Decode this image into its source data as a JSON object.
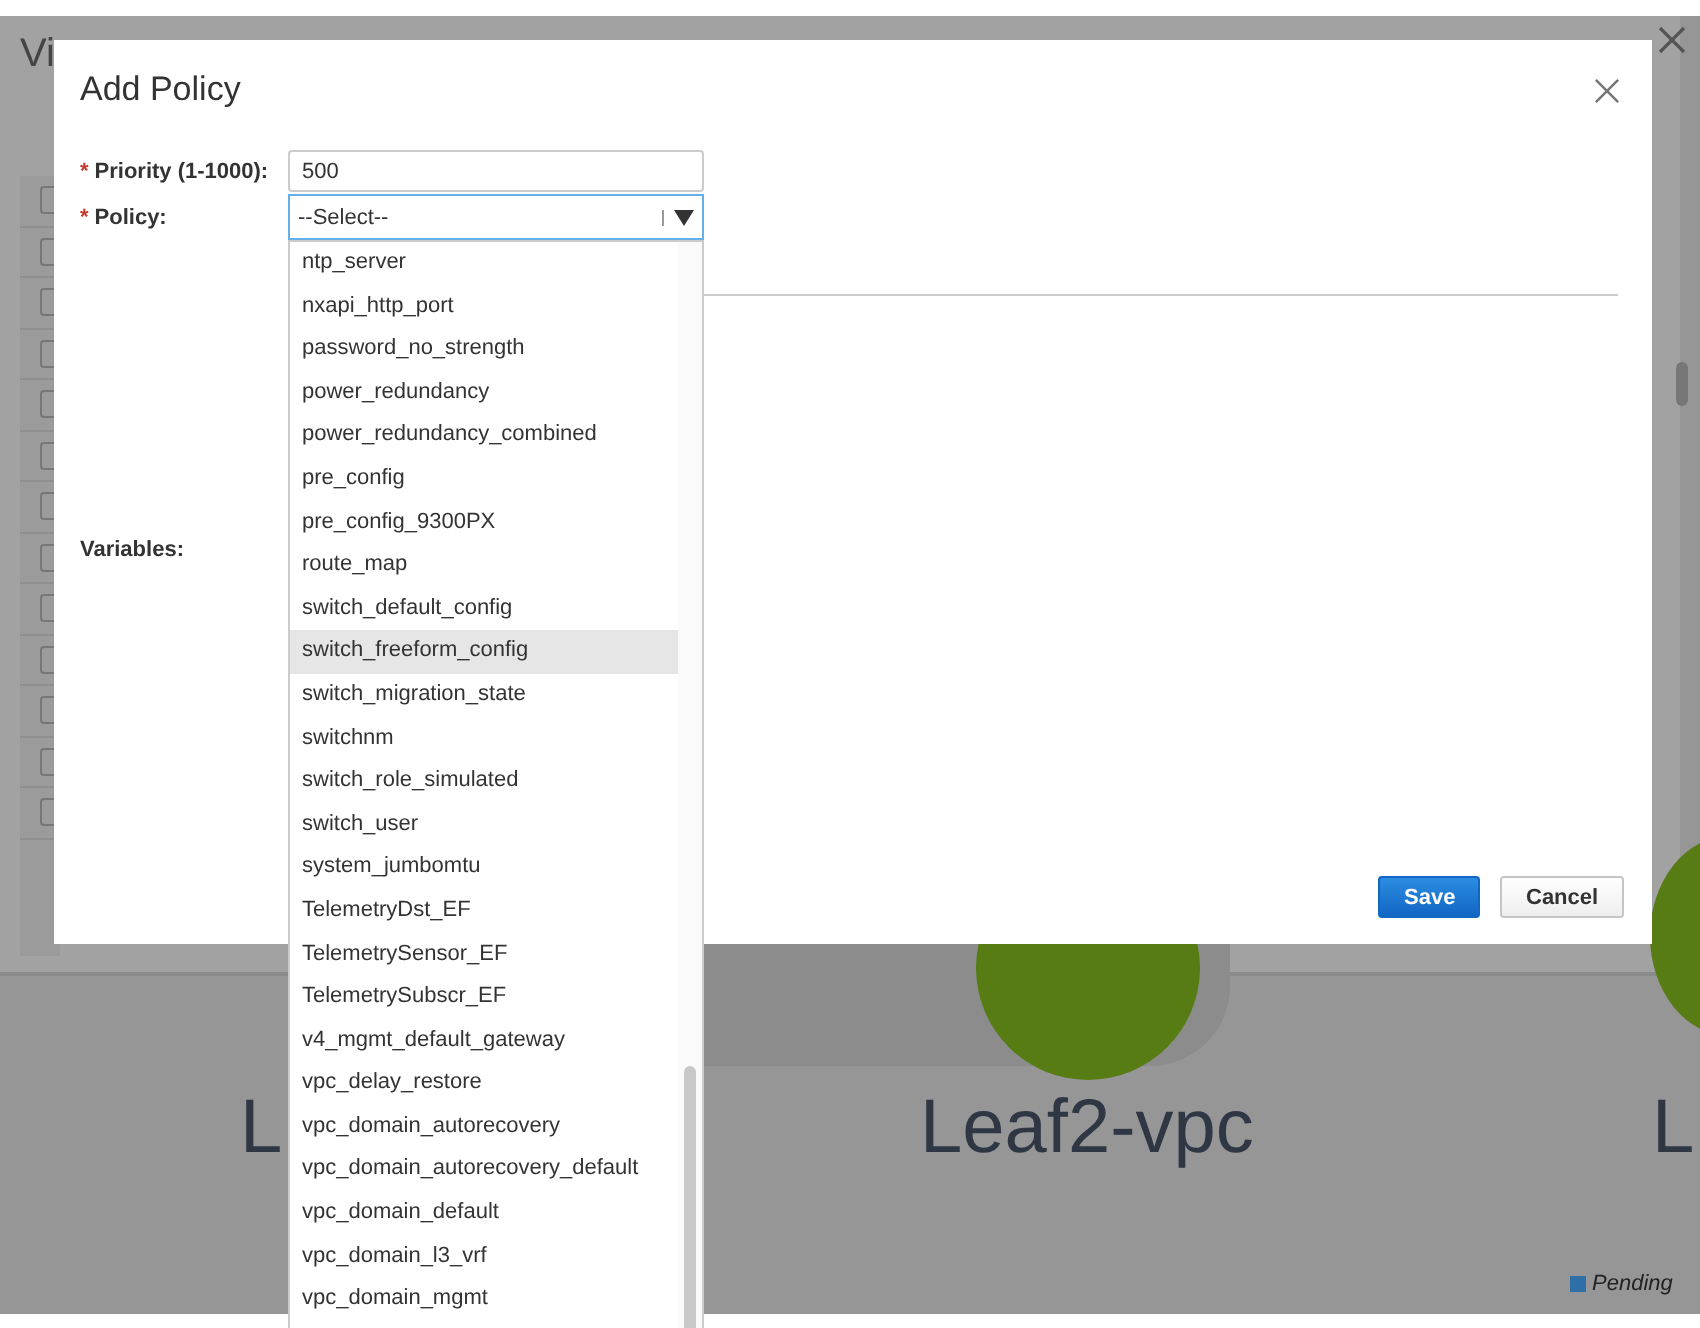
{
  "background": {
    "title": "Vi",
    "node_labels": [
      "L",
      "Leaf2-vpc",
      "L"
    ],
    "legend": {
      "label": "Pending",
      "color": "#2f6fa8"
    }
  },
  "dialog": {
    "title": "Add Policy",
    "fields": [
      {
        "label": "Priority (1-1000):",
        "required_mark": "*",
        "kind": "text",
        "value": "500"
      },
      {
        "label": "Policy:",
        "required_mark": "*",
        "kind": "select",
        "value": "--Select--",
        "expanded": true
      }
    ],
    "variables_label": "Variables:",
    "policy_options": [
      {
        "label": "ntp_server",
        "selected": false
      },
      {
        "label": "nxapi_http_port",
        "selected": false
      },
      {
        "label": "password_no_strength",
        "selected": false
      },
      {
        "label": "power_redundancy",
        "selected": false
      },
      {
        "label": "power_redundancy_combined",
        "selected": false
      },
      {
        "label": "pre_config",
        "selected": false
      },
      {
        "label": "pre_config_9300PX",
        "selected": false
      },
      {
        "label": "route_map",
        "selected": false
      },
      {
        "label": "switch_default_config",
        "selected": false
      },
      {
        "label": "switch_freeform_config",
        "selected": true
      },
      {
        "label": "switch_migration_state",
        "selected": false
      },
      {
        "label": "switchnm",
        "selected": false
      },
      {
        "label": "switch_role_simulated",
        "selected": false
      },
      {
        "label": "switch_user",
        "selected": false
      },
      {
        "label": "system_jumbomtu",
        "selected": false
      },
      {
        "label": "TelemetryDst_EF",
        "selected": false
      },
      {
        "label": "TelemetrySensor_EF",
        "selected": false
      },
      {
        "label": "TelemetrySubscr_EF",
        "selected": false
      },
      {
        "label": "v4_mgmt_default_gateway",
        "selected": false
      },
      {
        "label": "vpc_delay_restore",
        "selected": false
      },
      {
        "label": "vpc_domain_autorecovery",
        "selected": false
      },
      {
        "label": "vpc_domain_autorecovery_default",
        "selected": false
      },
      {
        "label": "vpc_domain_default",
        "selected": false
      },
      {
        "label": "vpc_domain_l3_vrf",
        "selected": false
      },
      {
        "label": "vpc_domain_mgmt",
        "selected": false
      }
    ],
    "buttons": [
      {
        "label": "Save",
        "kind": "primary"
      },
      {
        "label": "Cancel",
        "kind": "secondary"
      }
    ]
  }
}
